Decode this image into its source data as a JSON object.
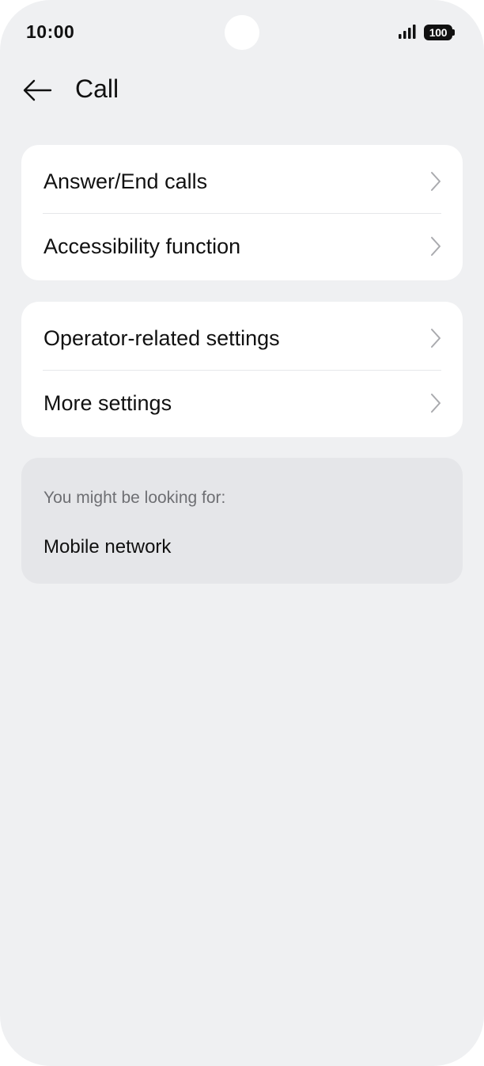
{
  "status_bar": {
    "time": "10:00",
    "battery_level": "100",
    "icons": [
      "signal-icon",
      "battery-icon"
    ]
  },
  "header": {
    "back_icon": "arrow-left-icon",
    "title": "Call"
  },
  "groups": [
    {
      "items": [
        {
          "label": "Answer/End calls",
          "icon": "chevron-right-icon"
        },
        {
          "label": "Accessibility function",
          "icon": "chevron-right-icon"
        }
      ]
    },
    {
      "items": [
        {
          "label": "Operator-related settings",
          "icon": "chevron-right-icon"
        },
        {
          "label": "More settings",
          "icon": "chevron-right-icon"
        }
      ]
    }
  ],
  "suggestions": {
    "heading": "You might be looking for:",
    "items": [
      {
        "label": "Mobile network"
      }
    ]
  },
  "colors": {
    "background": "#eff0f2",
    "card": "#ffffff",
    "suggestion_card": "#e5e6e9",
    "text_primary": "#111111",
    "text_secondary": "#6e6f73"
  }
}
